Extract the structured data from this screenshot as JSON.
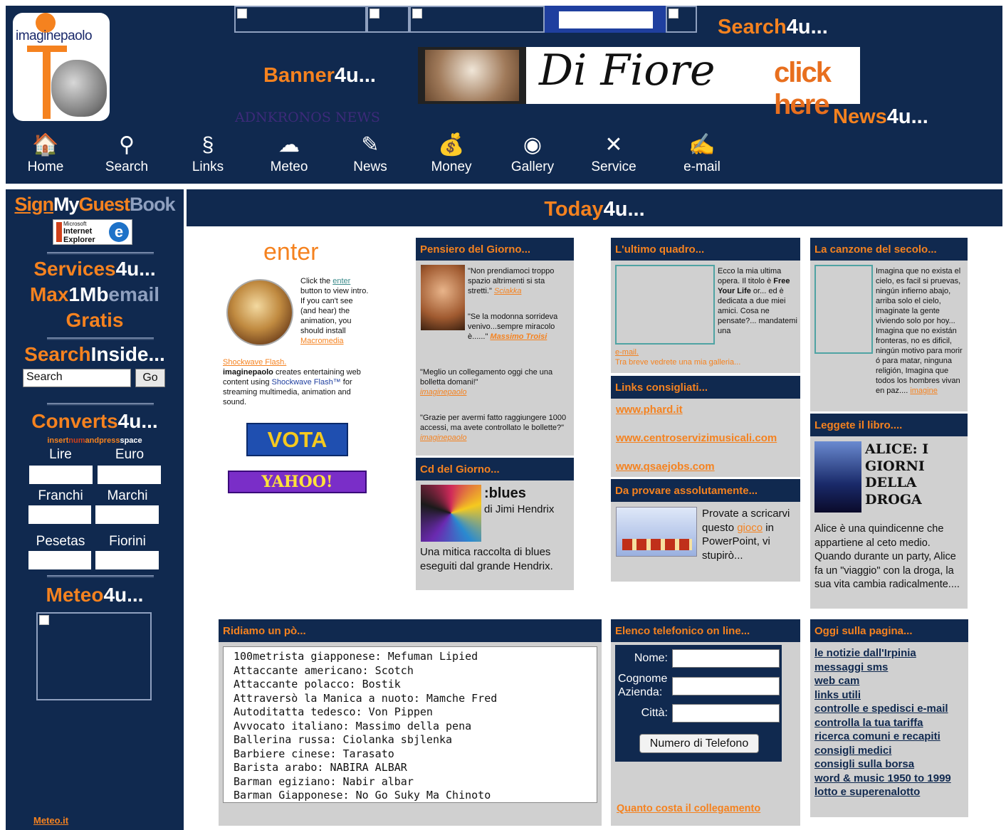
{
  "header": {
    "logo_text": "imaginepaolo",
    "search_title_a": "Search",
    "search_title_b": "4u...",
    "banner_title_a": "Banner",
    "banner_title_b": "4u...",
    "news_title_a": "News",
    "news_title_b": "4u...",
    "adnkronos": "ADNKRONOS NEWS",
    "difiore_script": "Di Fiore",
    "difiore_click": "click here"
  },
  "nav": [
    {
      "label": "Home",
      "icon": "home-icon",
      "glyph": "🏠"
    },
    {
      "label": "Search",
      "icon": "magnifier-icon",
      "glyph": "⚲"
    },
    {
      "label": "Links",
      "icon": "chain-link-icon",
      "glyph": "§"
    },
    {
      "label": "Meteo",
      "icon": "cloud-icon",
      "glyph": "☁"
    },
    {
      "label": "News",
      "icon": "notepad-icon",
      "glyph": "✎"
    },
    {
      "label": "Money",
      "icon": "money-bag-icon",
      "glyph": "💰"
    },
    {
      "label": "Gallery",
      "icon": "eye-icon",
      "glyph": "◉"
    },
    {
      "label": "Service",
      "icon": "tools-icon",
      "glyph": "✕"
    },
    {
      "label": "e-mail",
      "icon": "pen-icon",
      "glyph": "✍"
    }
  ],
  "sidebar": {
    "guestbook_sign": "Sign",
    "guestbook_my": "My",
    "guestbook_guest": "Guest",
    "guestbook_book": "Book",
    "ie_badge_top": "Microsoft",
    "ie_badge_mid": "Internet",
    "ie_badge_bot": "Explorer",
    "services_a": "Services",
    "services_b": "4u...",
    "max_a": "Max",
    "max_b": "1Mb",
    "max_c": "email",
    "gratis": "Gratis",
    "searchinside_a": "Search",
    "searchinside_b": "Inside...",
    "search_value": "Search",
    "go_label": "Go",
    "converts_a": "Converts",
    "converts_b": "4u...",
    "insert_a": "insert",
    "insert_b": "num",
    "insert_c": "andpress",
    "insert_d": "space",
    "currencies": [
      "Lire",
      "Euro",
      "Franchi",
      "Marchi",
      "Pesetas",
      "Fiorini"
    ],
    "meteo_a": "Meteo",
    "meteo_b": "4u...",
    "meteo_link": "Meteo.it"
  },
  "today": {
    "a": "Today",
    "b": "4u..."
  },
  "enter": {
    "title": "enter",
    "line1": "Click the",
    "link": "enter",
    "line2": "button to view intro.",
    "line3": "If you can't see (and hear) the animation, you should install",
    "macromedia": "Macromedia",
    "shockwave_flash": "Shockwave Flash.",
    "desc_a": "imaginepaolo",
    "desc_b": "creates entertaining web content using",
    "desc_shock": "Shockwave Flash™",
    "desc_c": "for streaming multimedia, animation and sound.",
    "vota": "VOTA",
    "yahoo": "YAHOO!"
  },
  "pensiero": {
    "title": "Pensiero del Giorno...",
    "q1": "\"Non prendiamoci troppo spazio altrimenti si sta stretti.\"",
    "a1": "Sciakka",
    "q2": "\"Se la modonna sorrideva venivo...sempre miracolo è......\"",
    "a2": "Massimo Troisi",
    "q3": "\"Meglio un collegamento oggi che una bolletta domani!\"",
    "a3": "imaginepaolo",
    "q4": "\"Grazie per avermi fatto raggiungere 1000 accessi, ma avete controllato le bollette?\"",
    "a4": "imaginepaolo"
  },
  "cd": {
    "title": "Cd del Giorno...",
    "album": ":blues",
    "artist": "di Jimi Hendrix",
    "desc": "Una mitica raccolta di blues eseguiti dal grande Hendrix."
  },
  "quadro": {
    "title": "L'ultimo quadro...",
    "text_a": "Ecco la mia ultima opera. Il titolo è",
    "text_b": "Free Your Life",
    "text_c": "or... ed è dedicata a due miei amici. Cosa ne pensate?... mandatemi una",
    "mail_link": "e-mail.",
    "galleria": "Tra breve vedrete una mia galleria..."
  },
  "links": {
    "title": "Links consigliati...",
    "items": [
      "www.phard.it",
      "www.centroservizimusicali.com",
      "www.qsaejobs.com"
    ]
  },
  "provare": {
    "title": "Da provare assolutamente...",
    "text_a": "Provate a scricarvi questo",
    "gioco": "gioco",
    "text_b": "in PowerPoint, vi stupirò..."
  },
  "canzone": {
    "title": "La canzone del secolo...",
    "text": "Imagina que no exista el cielo, es facil si pruevas, ningún infierno abajo, arriba solo el cielo, imaginate la gente viviendo solo por hoy... Imagina que no existán fronteras, no es dificil, ningún motivo para morir ó para matar, ninguna religión, Imagina que todos los hombres vivan en paz....",
    "link": "imagine"
  },
  "libro": {
    "title": "Leggete il libro....",
    "book_title": "ALICE: I GIORNI DELLA DROGA",
    "desc": "Alice è una quindicenne che appartiene al ceto medio. Quando durante un party, Alice fa un \"viaggio\" con la droga, la sua vita cambia radicalmente...."
  },
  "ridiamo": {
    "title": "Ridiamo un pò...",
    "lines": [
      "100metrista giapponese: Mefuman Lipied",
      "Attaccante americano: Scotch",
      "Attaccante polacco: Bostik",
      "Attraversò la Manica a nuoto: Mamche Fred",
      "Autoditatta tedesco: Von Pippen",
      "Avvocato italiano: Massimo della pena",
      "Ballerina russa: Ciolanka sbjlenka",
      "Barbiere cinese: Tarasato",
      "Barista arabo: NABIRA ALBAR",
      "Barman egiziano: Nabir albar",
      "Barman Giapponese: No Go Suky Ma Chinoto"
    ]
  },
  "elenco": {
    "title": "Elenco telefonico on line...",
    "nome": "Nome:",
    "cognome": "Cognome",
    "azienda": "Azienda:",
    "citta": "Città:",
    "button": "Numero di Telefono",
    "quanto": "Quanto costa il collegamento"
  },
  "oggi": {
    "title": "Oggi sulla pagina...",
    "items": [
      "le notizie dall'Irpinia",
      "messaggi sms",
      "web cam",
      "links utili",
      "controlle e spedisci e-mail",
      "controlla la tua tariffa",
      "ricerca comuni e recapiti",
      "consigli medici",
      "consigli sulla borsa",
      "word & music 1950 to 1999",
      "lotto e superenalotto"
    ]
  },
  "colors": {
    "navy": "#10294f",
    "orange": "#f5821f",
    "grey": "#d0d0d0"
  }
}
